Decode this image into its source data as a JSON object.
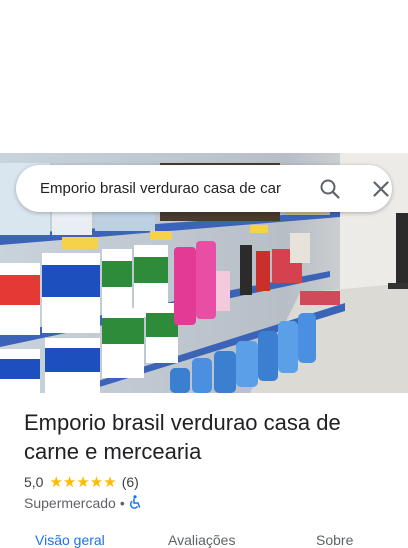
{
  "search": {
    "query": "Emporio brasil verdurao casa de car",
    "search_icon": "search-icon",
    "close_icon": "close-icon"
  },
  "place": {
    "name": "Emporio brasil verdurao casa de carne e mercearia",
    "rating": "5,0",
    "stars": "★★★★★",
    "review_count": "(6)",
    "category": "Supermercado",
    "separator": "•",
    "accessibility_icon": "wheelchair-icon"
  },
  "tabs": [
    {
      "label": "Visão geral",
      "active": true
    },
    {
      "label": "Avaliações",
      "active": false
    },
    {
      "label": "Sobre",
      "active": false
    }
  ],
  "colors": {
    "accent": "#1a73e8",
    "star": "#fbbc04",
    "text": "#202124"
  }
}
